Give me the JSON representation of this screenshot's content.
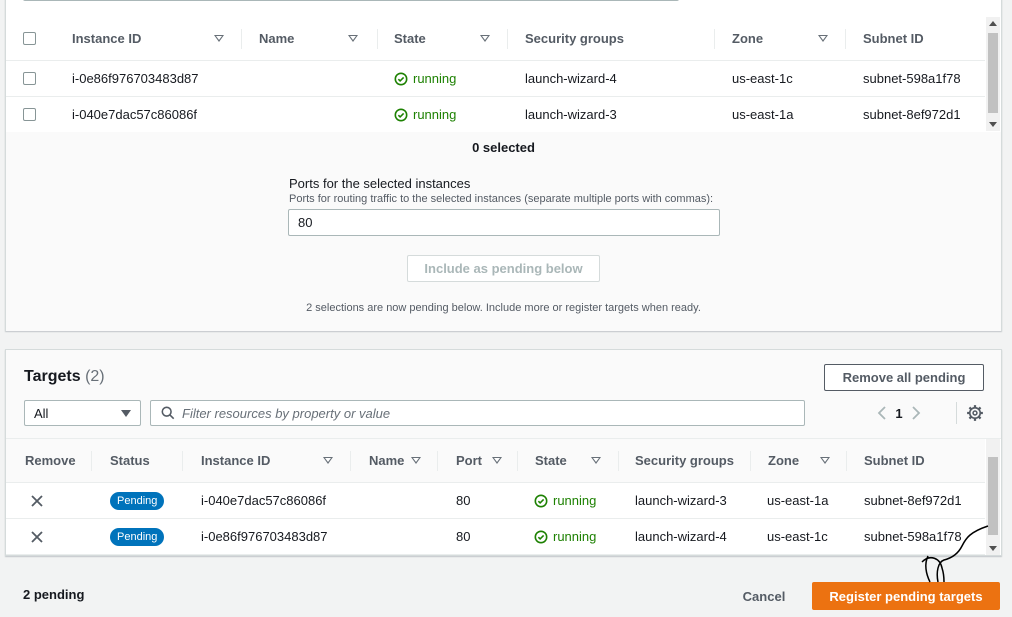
{
  "available": {
    "columns": [
      "Instance ID",
      "Name",
      "State",
      "Security groups",
      "Zone",
      "Subnet ID"
    ],
    "rows": [
      {
        "instance_id": "i-0e86f976703483d87",
        "name": "",
        "state": "running",
        "security_group": "launch-wizard-4",
        "zone": "us-east-1c",
        "subnet_id": "subnet-598a1f78"
      },
      {
        "instance_id": "i-040e7dac57c86086f",
        "name": "",
        "state": "running",
        "security_group": "launch-wizard-3",
        "zone": "us-east-1a",
        "subnet_id": "subnet-8ef972d1"
      }
    ],
    "selected_count": "0 selected",
    "ports_label": "Ports for the selected instances",
    "ports_description": "Ports for routing traffic to the selected instances (separate multiple ports with commas):",
    "ports_value": "80",
    "include_button": "Include as pending below",
    "pending_note": "2 selections are now pending below. Include more or register targets when ready."
  },
  "targets": {
    "title": "Targets",
    "count": "(2)",
    "remove_all_button": "Remove all pending",
    "filter_select": "All",
    "filter_placeholder": "Filter resources by property or value",
    "page": "1",
    "columns": [
      "Remove",
      "Status",
      "Instance ID",
      "Name",
      "Port",
      "State",
      "Security groups",
      "Zone",
      "Subnet ID"
    ],
    "rows": [
      {
        "status": "Pending",
        "instance_id": "i-040e7dac57c86086f",
        "name": "",
        "port": "80",
        "state": "running",
        "security_group": "launch-wizard-3",
        "zone": "us-east-1a",
        "subnet_id": "subnet-8ef972d1"
      },
      {
        "status": "Pending",
        "instance_id": "i-0e86f976703483d87",
        "name": "",
        "port": "80",
        "state": "running",
        "security_group": "launch-wizard-4",
        "zone": "us-east-1c",
        "subnet_id": "subnet-598a1f78"
      }
    ]
  },
  "footer": {
    "pending_text": "2 pending",
    "cancel_button": "Cancel",
    "register_button": "Register pending targets"
  },
  "colors": {
    "primary": "#ec7211",
    "running": "#1d8102",
    "badge": "#0073bb"
  },
  "icons": [
    "checkbox-icon",
    "sort-caret-icon",
    "check-circle-icon",
    "search-icon",
    "chevron-left-icon",
    "chevron-right-icon",
    "gear-icon",
    "close-icon",
    "dropdown-caret-icon"
  ]
}
